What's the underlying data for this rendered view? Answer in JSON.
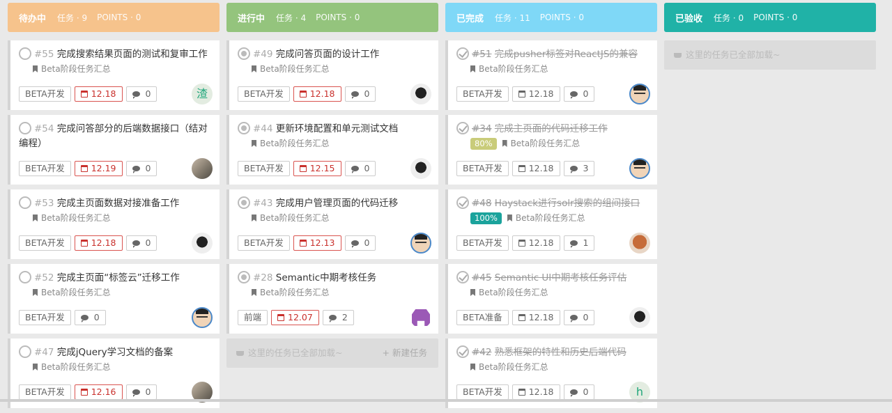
{
  "columns": [
    {
      "name": "待办中",
      "count_label": "任务 · 9",
      "points_label": "POINTS · 0",
      "color": "#f6c38c",
      "cards": [
        {
          "num": "#55",
          "title": "完成搜索结果页面的测试和复审工作",
          "project": "Beta阶段任务汇总",
          "tag": "BETA开发",
          "date": "12.18",
          "comments": "0",
          "avatar": "av-char",
          "avatar_text": "渣"
        },
        {
          "num": "#54",
          "title": "完成问答部分的后端数据接口（结对编程）",
          "project": "Beta阶段任务汇总",
          "tag": "BETA开发",
          "date": "12.19",
          "comments": "0",
          "avatar": "av-photo",
          "wrap": true
        },
        {
          "num": "#53",
          "title": "完成主页面数据对接准备工作",
          "project": "Beta阶段任务汇总",
          "tag": "BETA开发",
          "date": "12.18",
          "comments": "0",
          "avatar": "av-dark"
        },
        {
          "num": "#52",
          "title": "完成主页面“标签云”迁移工作",
          "project": "Beta阶段任务汇总",
          "tag": "BETA开发",
          "date": "",
          "comments": "0",
          "avatar": "av-face"
        },
        {
          "num": "#47",
          "title": "完成jQuery学习文档的备案",
          "project": "Beta阶段任务汇总",
          "tag": "BETA开发",
          "date": "12.16",
          "comments": "0",
          "avatar": "av-photo"
        }
      ]
    },
    {
      "name": "进行中",
      "count_label": "任务 · 4",
      "points_label": "POINTS · 0",
      "color": "#94c47d",
      "cards": [
        {
          "num": "#49",
          "title": "完成问答页面的设计工作",
          "project": "Beta阶段任务汇总",
          "tag": "BETA开发",
          "date": "12.18",
          "comments": "0",
          "avatar": "av-dark"
        },
        {
          "num": "#44",
          "title": "更新环境配置和单元测试文档",
          "project": "Beta阶段任务汇总",
          "tag": "BETA开发",
          "date": "12.15",
          "comments": "0",
          "avatar": "av-dark"
        },
        {
          "num": "#43",
          "title": "完成用户管理页面的代码迁移",
          "project": "Beta阶段任务汇总",
          "tag": "BETA开发",
          "date": "12.13",
          "comments": "0",
          "avatar": "av-face"
        },
        {
          "num": "#28",
          "title": "Semantic中期考核任务",
          "project": "Beta阶段任务汇总",
          "tag": "前端",
          "date": "12.07",
          "comments": "2",
          "avatar": "av-pixel"
        }
      ],
      "loaded_text": "这里的任务已全部加载~",
      "new_task_label": "+ 新建任务"
    },
    {
      "name": "已完成",
      "count_label": "任务 · 11",
      "points_label": "POINTS · 0",
      "color": "#7fd8f7",
      "cards": [
        {
          "num": "#51",
          "title": "完成pusher标签对ReactJS的兼容",
          "project": "Beta阶段任务汇总",
          "tag": "BETA开发",
          "date": "12.18",
          "comments": "0",
          "avatar": "av-face"
        },
        {
          "num": "#34",
          "title": "完成主页面的代码迁移工作",
          "project": "Beta阶段任务汇总",
          "pct": "80%",
          "pct_color": "#c9cc7a",
          "tag": "BETA开发",
          "date": "12.18",
          "comments": "3",
          "avatar": "av-face"
        },
        {
          "num": "#48",
          "title": "Haystack进行solr搜索的组间接口",
          "project": "Beta阶段任务汇总",
          "pct": "100%",
          "pct_color": "#1ba39c",
          "tag": "BETA开发",
          "date": "12.18",
          "comments": "1",
          "avatar": "av-orange"
        },
        {
          "num": "#45",
          "title": "Semantic UI中期考核任务评估",
          "project": "Beta阶段任务汇总",
          "tag": "BETA准备",
          "date": "12.18",
          "comments": "0",
          "avatar": "av-dark"
        },
        {
          "num": "#42",
          "title": "熟悉框架的特性和历史后端代码",
          "project": "Beta阶段任务汇总",
          "tag": "BETA开发",
          "date": "12.18",
          "comments": "0",
          "avatar": "av-char",
          "avatar_text": "h"
        }
      ]
    },
    {
      "name": "已验收",
      "count_label": "任务 · 0",
      "points_label": "POINTS · 0",
      "color": "#20b2a7",
      "cards": [],
      "loaded_text": "这里的任务已全部加载~"
    }
  ]
}
